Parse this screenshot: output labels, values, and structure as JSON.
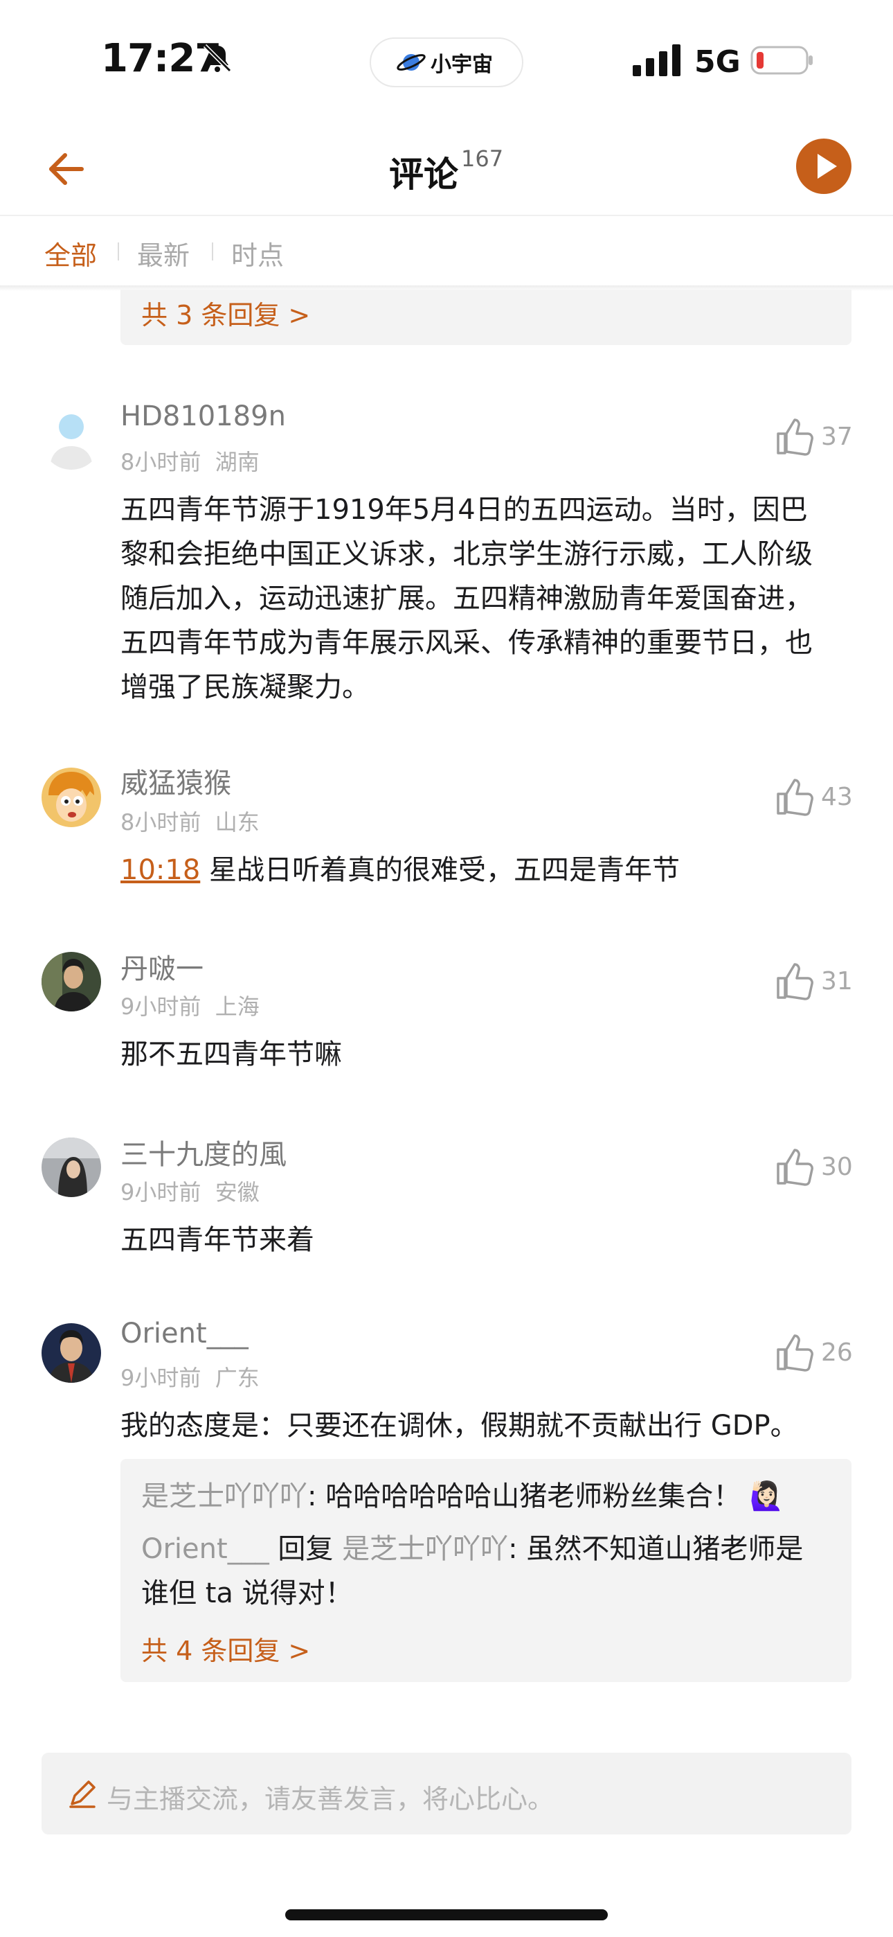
{
  "status_bar": {
    "time": "17:27",
    "app_pill": "小宇宙",
    "network": "5G",
    "icons": [
      "bell-slash-icon",
      "planet-logo-icon",
      "signal-icon",
      "battery-icon"
    ],
    "battery_color": "#e53935"
  },
  "header": {
    "title": "评论",
    "count": "167",
    "icons": [
      "back-arrow-icon",
      "play-icon"
    ],
    "accent": "#c65f1a"
  },
  "tabs": [
    {
      "label": "全部",
      "active": true
    },
    {
      "label": "最新",
      "active": false
    },
    {
      "label": "时点",
      "active": false
    }
  ],
  "top_partial": {
    "more_replies": "共 3 条回复 >"
  },
  "comments": [
    {
      "user": "HD810189n",
      "time": "8小时前",
      "region": "湖南",
      "likes": "37",
      "lines": [
        "五四青年节源于1919年5月4日的五四运动。当时，因巴",
        "黎和会拒绝中国正义诉求，北京学生游行示威，工人阶级",
        "随后加入，运动迅速扩展。五四精神激励青年爱国奋进，",
        "五四青年节成为青年展示风采、传承精神的重要节日，也",
        "增强了民族凝聚力。"
      ]
    },
    {
      "user": "威猛猿猴",
      "time": "8小时前",
      "region": "山东",
      "likes": "43",
      "timestamp": "10:18",
      "text": "星战日听着真的很难受，五四是青年节"
    },
    {
      "user": "丹啵一",
      "time": "9小时前",
      "region": "上海",
      "likes": "31",
      "text": "那不五四青年节嘛"
    },
    {
      "user": "三十九度的風",
      "time": "9小时前",
      "region": "安徽",
      "likes": "30",
      "text": "五四青年节来着"
    },
    {
      "user": "Orient___",
      "time": "9小时前",
      "region": "广东",
      "likes": "26",
      "text": "我的态度是：只要还在调休，假期就不贡献出行 GDP。",
      "replies": [
        {
          "name": "是芝士吖吖吖",
          "sep": ": ",
          "text": "哈哈哈哈哈哈山猪老师粉丝集合！",
          "emoji": "🙋🏻‍♀️"
        },
        {
          "name": "Orient___",
          "mid": " 回复 ",
          "target": "是芝士吖吖吖",
          "sep": ": ",
          "text_line1": "虽然不知道山猪老师是",
          "text_line2": "谁但 ta 说得对！"
        }
      ],
      "more_replies": "共 4 条回复 >"
    }
  ],
  "input": {
    "placeholder": "与主播交流，请友善发言，将心比心。",
    "icon": "pencil-icon"
  }
}
